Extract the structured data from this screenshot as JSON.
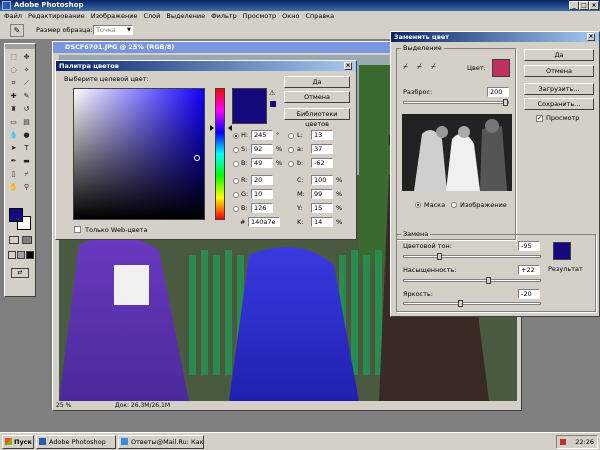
{
  "app": {
    "title": "Adobe Photoshop",
    "menu": [
      "Файл",
      "Редактирование",
      "Изображение",
      "Слой",
      "Выделение",
      "Фильтр",
      "Просмотр",
      "Окно",
      "Справка"
    ]
  },
  "options_bar": {
    "sample_size_label": "Размер образца:",
    "sample_size_value": "Точка"
  },
  "document": {
    "title": "DSCF6701.JPG @ 25% (RGB/8)",
    "zoom": "25 %",
    "doc_info": "Док: 26,3M/26,1M"
  },
  "color_picker": {
    "title": "Палитра цветов",
    "prompt": "Выберите целевой цвет:",
    "ok": "Да",
    "cancel": "Отмена",
    "libraries": "Библиотеки цветов",
    "web_only": "Только Web-цвета",
    "selected_color": "#140a7e",
    "fields": {
      "H": "245",
      "S": "92",
      "B": "49",
      "R": "20",
      "G": "10",
      "Bb": "126",
      "L": "13",
      "a": "37",
      "b": "-62",
      "C": "100",
      "M": "99",
      "Y": "15",
      "K": "14",
      "hex": "140a7e"
    },
    "units": {
      "deg": "°",
      "pct": "%"
    }
  },
  "replace_color": {
    "title": "Заменить цвет",
    "selection_group": "Выделение",
    "color_label": "Цвет:",
    "sample_color": "#c03060",
    "fuzziness_label": "Разброс:",
    "fuzziness_value": "200",
    "fuzziness_level": 1.0,
    "ok": "Да",
    "cancel": "Отмена",
    "load": "Загрузить...",
    "save": "Сохранить...",
    "preview": "Просмотр",
    "mask_option": "Маска",
    "image_option": "Изображение",
    "replace_group": "Замена",
    "hue_label": "Цветовой тон:",
    "hue_value": "-95",
    "saturation_label": "Насыщенность:",
    "saturation_value": "+22",
    "lightness_label": "Яркость:",
    "lightness_value": "-20",
    "result_label": "Результат",
    "result_color": "#140a7e"
  },
  "taskbar": {
    "start": "Пуск",
    "tasks": [
      "Adobe Photoshop",
      "Ответы@Mail.Ru: Как в..."
    ],
    "clock": "22:26"
  },
  "colors": {
    "foreground": "#140a7e",
    "background": "#ffffff",
    "titlebar": "#0a246a"
  }
}
